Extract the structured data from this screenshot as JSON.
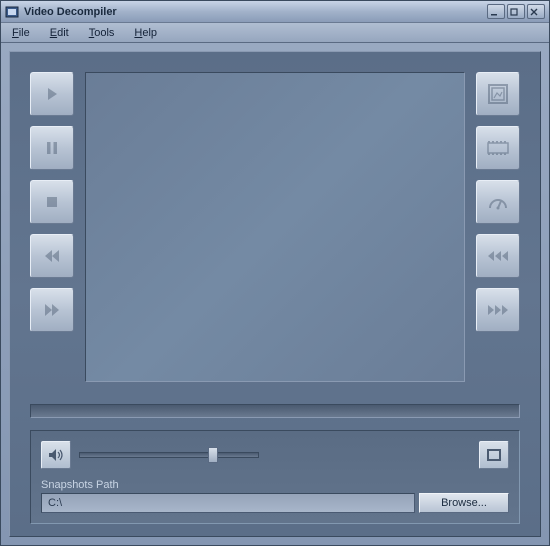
{
  "window": {
    "title": "Video Decompiler"
  },
  "menubar": {
    "file": "File",
    "edit": "Edit",
    "tools": "Tools",
    "help": "Help"
  },
  "snapshots": {
    "label": "Snapshots Path",
    "value": "C:\\",
    "browse": "Browse..."
  },
  "icons": {
    "play": "play-icon",
    "pause": "pause-icon",
    "stop": "stop-icon",
    "rewind": "rewind-icon",
    "forward": "forward-icon",
    "snapshot": "snapshot-icon",
    "film": "film-icon",
    "speed": "speed-icon",
    "step_back": "step-back-icon",
    "step_fwd": "step-forward-icon",
    "volume": "volume-icon",
    "fullscreen": "fullscreen-icon",
    "minimize": "minimize-icon",
    "maximize": "maximize-icon",
    "close": "close-icon"
  },
  "colors": {
    "panel_bg": "#5b6e88",
    "button_light": "#d8e0ea",
    "button_dark": "#a0aec2"
  }
}
